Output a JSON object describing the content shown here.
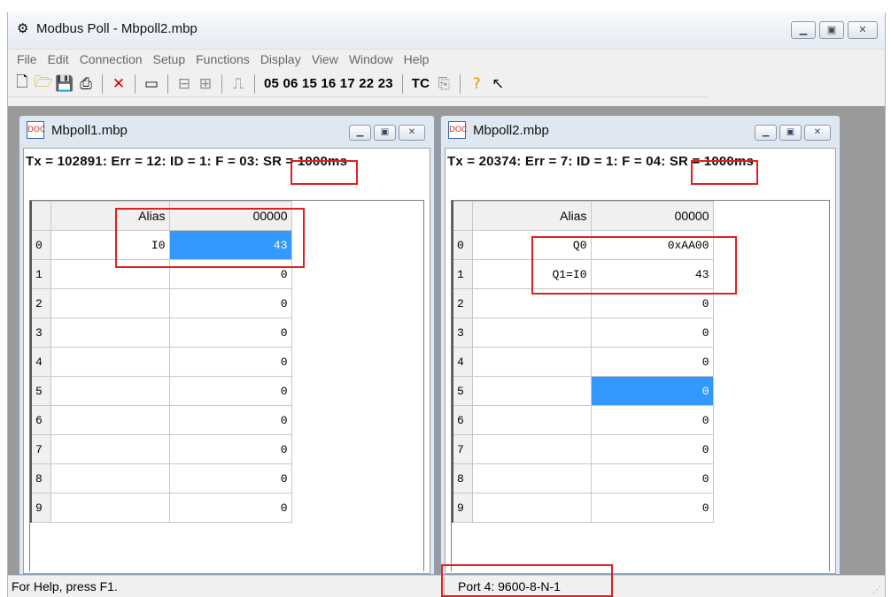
{
  "window": {
    "title": "Modbus Poll - Mbpoll2.mbp"
  },
  "menu": [
    "File",
    "Edit",
    "Connection",
    "Setup",
    "Functions",
    "Display",
    "View",
    "Window",
    "Help"
  ],
  "toolbar": {
    "function_codes": "05 06 15 16 17 22 23",
    "tc_label": "TC"
  },
  "child1": {
    "title": "Mbpoll1.mbp",
    "status": "Tx = 102891: Err = 12: ID = 1: F = 03: SR = 1000ms",
    "header": {
      "alias": "Alias",
      "col": "00000"
    },
    "rows": [
      {
        "n": "0",
        "alias": "I0",
        "value": "43"
      },
      {
        "n": "1",
        "alias": "",
        "value": "0"
      },
      {
        "n": "2",
        "alias": "",
        "value": "0"
      },
      {
        "n": "3",
        "alias": "",
        "value": "0"
      },
      {
        "n": "4",
        "alias": "",
        "value": "0"
      },
      {
        "n": "5",
        "alias": "",
        "value": "0"
      },
      {
        "n": "6",
        "alias": "",
        "value": "0"
      },
      {
        "n": "7",
        "alias": "",
        "value": "0"
      },
      {
        "n": "8",
        "alias": "",
        "value": "0"
      },
      {
        "n": "9",
        "alias": "",
        "value": "0"
      }
    ]
  },
  "child2": {
    "title": "Mbpoll2.mbp",
    "status": "Tx = 20374: Err = 7: ID = 1: F = 04: SR = 1000ms",
    "header": {
      "alias": "Alias",
      "col": "00000"
    },
    "rows": [
      {
        "n": "0",
        "alias": "Q0",
        "value": "0xAA00"
      },
      {
        "n": "1",
        "alias": "Q1=I0",
        "value": "43"
      },
      {
        "n": "2",
        "alias": "",
        "value": "0"
      },
      {
        "n": "3",
        "alias": "",
        "value": "0"
      },
      {
        "n": "4",
        "alias": "",
        "value": "0"
      },
      {
        "n": "5",
        "alias": "",
        "value": "0"
      },
      {
        "n": "6",
        "alias": "",
        "value": "0"
      },
      {
        "n": "7",
        "alias": "",
        "value": "0"
      },
      {
        "n": "8",
        "alias": "",
        "value": "0"
      },
      {
        "n": "9",
        "alias": "",
        "value": "0"
      }
    ]
  },
  "statusbar": {
    "help": "For Help, press F1.",
    "port": "Port 4: 9600-8-N-1"
  },
  "colors": {
    "highlight": "#e02020",
    "selection": "#3399ff",
    "mdi_bg": "#9a9a9a"
  }
}
